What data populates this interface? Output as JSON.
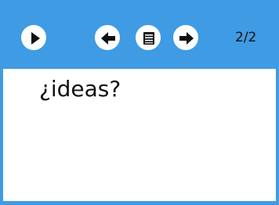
{
  "toolbar": {
    "play_icon": "play-icon",
    "prev_icon": "arrow-left-icon",
    "menu_icon": "list-icon",
    "next_icon": "arrow-right-icon",
    "page_indicator": "2/2"
  },
  "slide": {
    "text": "¿ideas?"
  },
  "colors": {
    "toolbar": "#3f9be3",
    "button": "#ffffff",
    "glyph": "#111111",
    "background": "#ffffff"
  }
}
